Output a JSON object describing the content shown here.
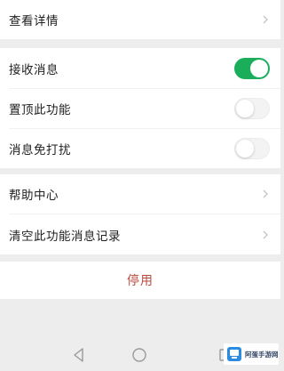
{
  "rows": {
    "details": "查看详情",
    "receive": "接收消息",
    "pin": "置顶此功能",
    "mute": "消息免打扰",
    "help": "帮助中心",
    "clear": "清空此功能消息记录"
  },
  "toggles": {
    "receive_on": true,
    "pin_on": false,
    "mute_on": false
  },
  "disable_label": "停用",
  "watermark": "阿蛋手游网",
  "colors": {
    "toggle_on": "#1aad5a",
    "disable_text": "#b84a3e",
    "background": "#ededed"
  }
}
